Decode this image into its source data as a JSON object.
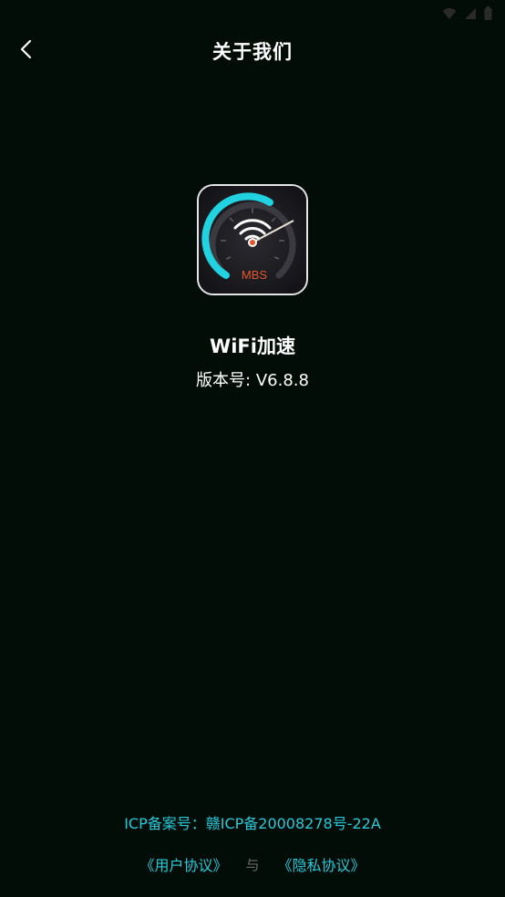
{
  "header": {
    "title": "关于我们"
  },
  "icons": {
    "back": "chevron-left-icon",
    "wifi": "wifi-signal-icon",
    "cell": "cellular-signal-icon",
    "battery": "battery-icon"
  },
  "app": {
    "logo_text": "MBS",
    "name": "WiFi加速",
    "version_line": "版本号: V6.8.8"
  },
  "footer": {
    "icp": "ICP备案号：赣ICP备20008278号-22A",
    "user_agreement": "《用户协议》",
    "separator": "与",
    "privacy_policy": "《隐私协议》"
  },
  "colors": {
    "background": "#020d08",
    "accent": "#28c9d8",
    "gauge_orange": "#e5552c"
  }
}
